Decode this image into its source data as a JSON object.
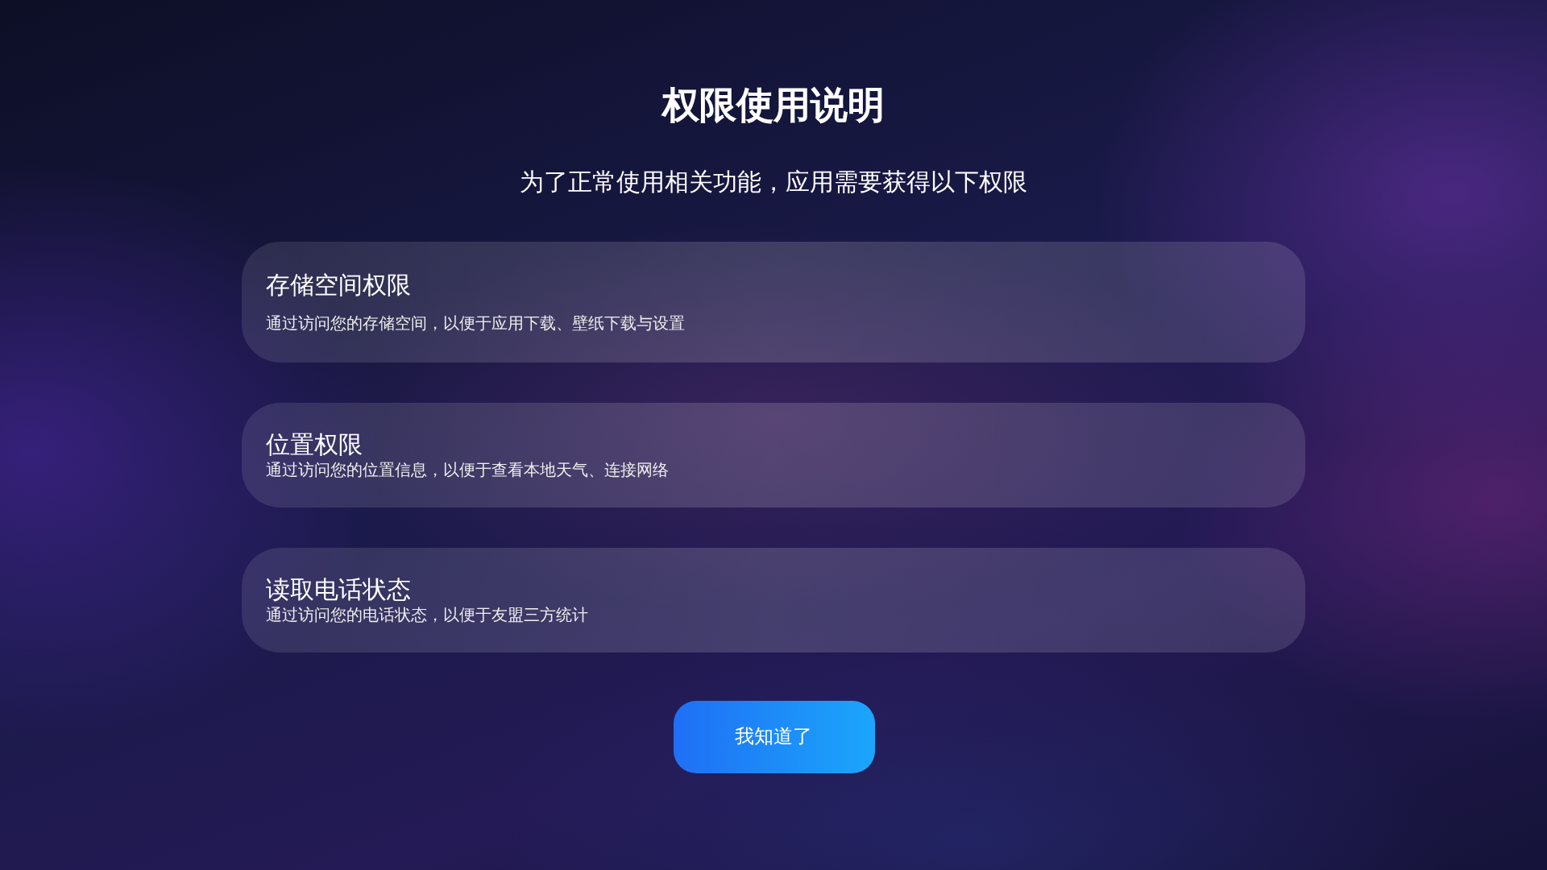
{
  "title": "权限使用说明",
  "subtitle": "为了正常使用相关功能，应用需要获得以下权限",
  "permissions": [
    {
      "name": "存储空间权限",
      "description": "通过访问您的存储空间，以便于应用下载、壁纸下载与设置"
    },
    {
      "name": "位置权限",
      "description": "通过访问您的位置信息，以便于查看本地天气、连接网络"
    },
    {
      "name": "读取电话状态",
      "description": "通过访问您的电话状态，以便于友盟三方统计"
    }
  ],
  "button": "我知道了"
}
